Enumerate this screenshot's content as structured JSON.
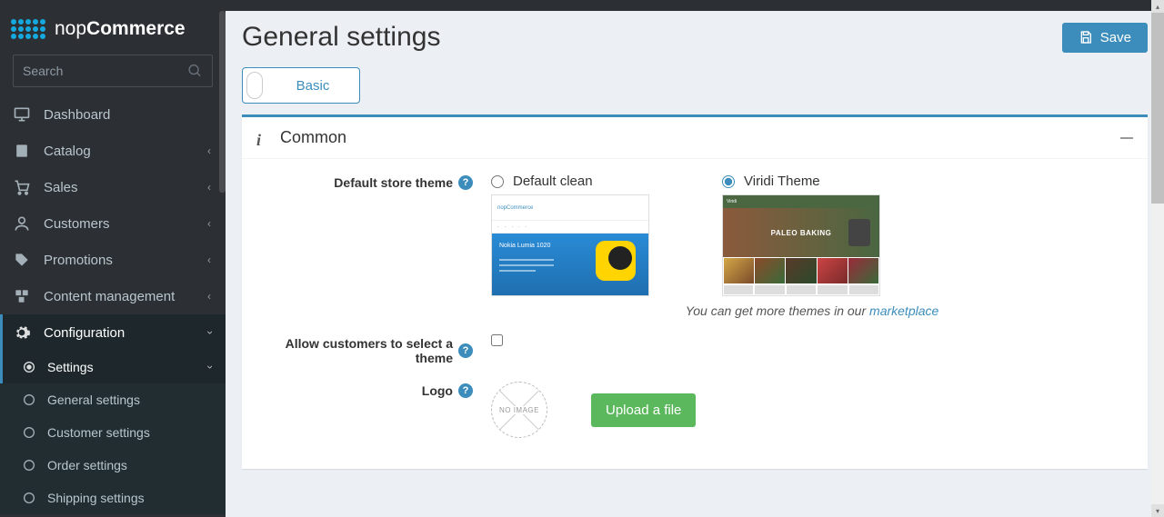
{
  "brand": {
    "prefix": "nop",
    "bold": "Commerce"
  },
  "search": {
    "placeholder": "Search"
  },
  "nav": {
    "dashboard": "Dashboard",
    "catalog": "Catalog",
    "sales": "Sales",
    "customers": "Customers",
    "promotions": "Promotions",
    "content": "Content management",
    "configuration": "Configuration",
    "settings": "Settings",
    "general": "General settings",
    "customerSettings": "Customer settings",
    "orderSettings": "Order settings",
    "shippingSettings": "Shipping settings"
  },
  "page": {
    "title": "General settings",
    "saveBtn": "Save",
    "modeToggle": "Basic"
  },
  "card": {
    "title": "Common"
  },
  "form": {
    "defaultThemeLabel": "Default store theme",
    "theme1": "Default clean",
    "theme2": "Viridi Theme",
    "themesHintPrefix": "You can get more themes in our ",
    "themesHintLink": "marketplace",
    "allowSelectTheme": "Allow customers to select a theme",
    "logoLabel": "Logo",
    "noImage": "NO IMAGE",
    "uploadBtn": "Upload a file",
    "viridiHero": "PALEO BAKING",
    "defaultHeroText": "Nokia Lumia 1020"
  }
}
